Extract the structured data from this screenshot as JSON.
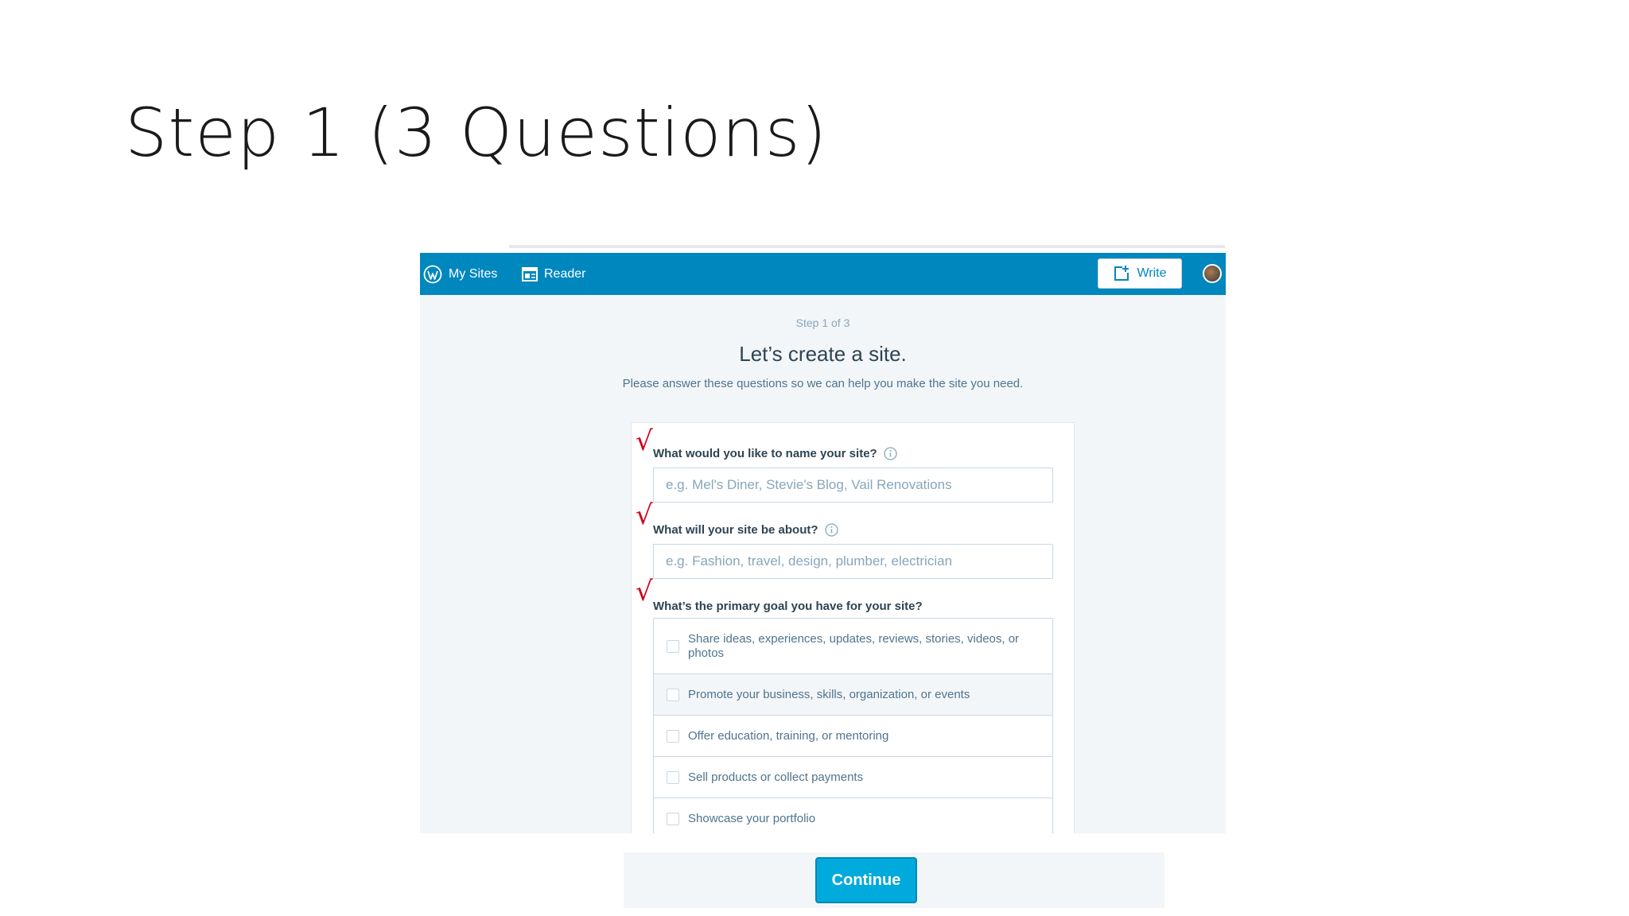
{
  "slide": {
    "title": "Step 1 (3 Questions)"
  },
  "masterbar": {
    "my_sites": "My Sites",
    "reader": "Reader",
    "write": "Write",
    "bg_color": "#0087be"
  },
  "signup": {
    "step": "Step 1 of 3",
    "heading": "Let’s create a site.",
    "subheading": "Please answer these questions so we can help you make the site you need.",
    "q1": {
      "label": "What would you like to name your site?",
      "placeholder": "e.g. Mel's Diner, Stevie's Blog, Vail Renovations"
    },
    "q2": {
      "label": "What will your site be about?",
      "placeholder": "e.g. Fashion, travel, design, plumber, electrician"
    },
    "q3": {
      "label": "What’s the primary goal you have for your site?",
      "options": [
        "Share ideas, experiences, updates, reviews, stories, videos, or photos",
        "Promote your business, skills, organization, or events",
        "Offer education, training, or mentoring",
        "Sell products or collect payments",
        "Showcase your portfolio"
      ]
    },
    "check_mark": "√"
  },
  "footer": {
    "continue": "Continue",
    "accent": "#00aadc"
  }
}
